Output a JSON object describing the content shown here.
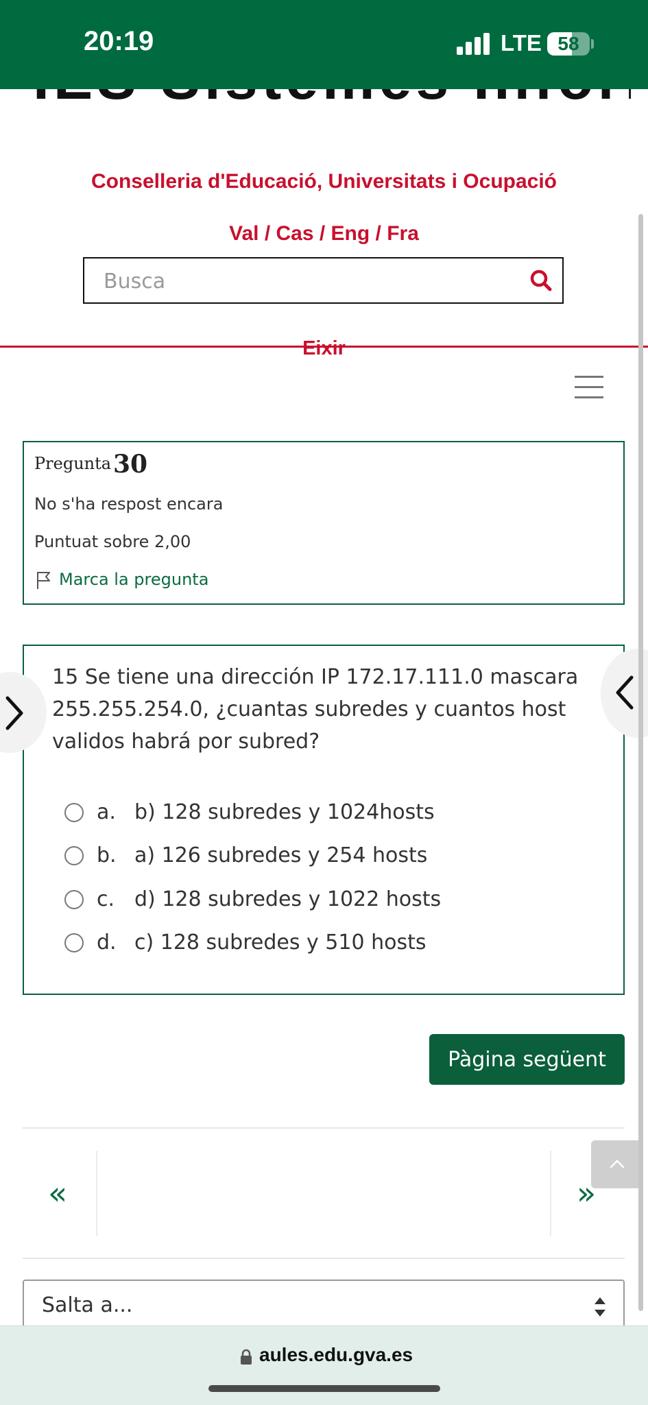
{
  "status_bar": {
    "time": "20:19",
    "network": "LTE",
    "battery": "58"
  },
  "site": {
    "title_cropped": "IES Sistemes Informàt...",
    "conselleria": "Conselleria d'Educació, Universitats i Ocupació",
    "languages": "Val / Cas / Eng / Fra",
    "logout": "Eixir"
  },
  "search": {
    "placeholder": "Busca",
    "value": ""
  },
  "question_info": {
    "label": "Pregunta",
    "number": "30",
    "status": "No s'ha respost encara",
    "score": "Puntuat sobre 2,00",
    "flag_label": "Marca la pregunta"
  },
  "question": {
    "text": "15 Se tiene una dirección IP 172.17.111.0 mascara 255.255.254.0, ¿cuantas subredes y cuantos host validos habrá por subred?",
    "options": [
      {
        "letter": "a.",
        "text": "b) 128 subredes y 1024hosts",
        "selected": false
      },
      {
        "letter": "b.",
        "text": "a) 126 subredes y 254 hosts",
        "selected": false
      },
      {
        "letter": "c.",
        "text": "d) 128 subredes y 1022 hosts",
        "selected": false
      },
      {
        "letter": "d.",
        "text": "c) 128 subredes y 510 hosts",
        "selected": false
      }
    ]
  },
  "buttons": {
    "next_page": "Pàgina següent"
  },
  "pager": {
    "prev_glyph": "«",
    "next_glyph": "»",
    "side_prev_glyph": "❯",
    "side_next_glyph": "❮"
  },
  "jump": {
    "label": "Salta a..."
  },
  "browser": {
    "url": "aules.edu.gva.es"
  },
  "colors": {
    "status_green": "#006b3f",
    "brand_red": "#c8102e",
    "accent_green": "#0b5f3b",
    "browser_bar": "#e1eeea"
  }
}
